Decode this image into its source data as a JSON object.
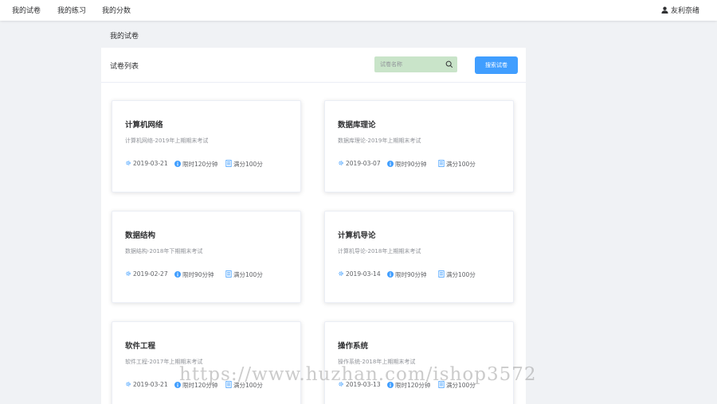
{
  "nav": {
    "items": [
      "我的试卷",
      "我的练习",
      "我的分数"
    ],
    "user": "友利奈绪"
  },
  "breadcrumb": "我的试卷",
  "panel": {
    "title": "试卷列表",
    "search_placeholder": "试卷名称",
    "search_button": "搜索试卷"
  },
  "cards": [
    {
      "title": "计算机网络",
      "desc": "计算机网络-2019年上期期末考试",
      "date": "2019-03-21",
      "time": "限时120分钟",
      "score": "满分100分"
    },
    {
      "title": "数据库理论",
      "desc": "数据库理论-2019年上期期末考试",
      "date": "2019-03-07",
      "time": "限时90分钟",
      "score": "满分100分"
    },
    {
      "title": "数据结构",
      "desc": "数据结构-2018年下期期末考试",
      "date": "2019-02-27",
      "time": "限时90分钟",
      "score": "满分100分"
    },
    {
      "title": "计算机导论",
      "desc": "计算机导论-2018年上期期末考试",
      "date": "2019-03-14",
      "time": "限时90分钟",
      "score": "满分100分"
    },
    {
      "title": "软件工程",
      "desc": "软件工程-2017年上期期末考试",
      "date": "2019-03-21",
      "time": "限时120分钟",
      "score": "满分100分"
    },
    {
      "title": "操作系统",
      "desc": "操作系统-2018年上期期末考试",
      "date": "2019-03-13",
      "time": "限时120分钟",
      "score": "满分100分"
    }
  ],
  "watermark": "https://www.huzhan.com/ishop3572",
  "colors": {
    "accent": "#409eff",
    "search_bg": "#c9e4c9",
    "page_bg": "#f0f2f5"
  }
}
